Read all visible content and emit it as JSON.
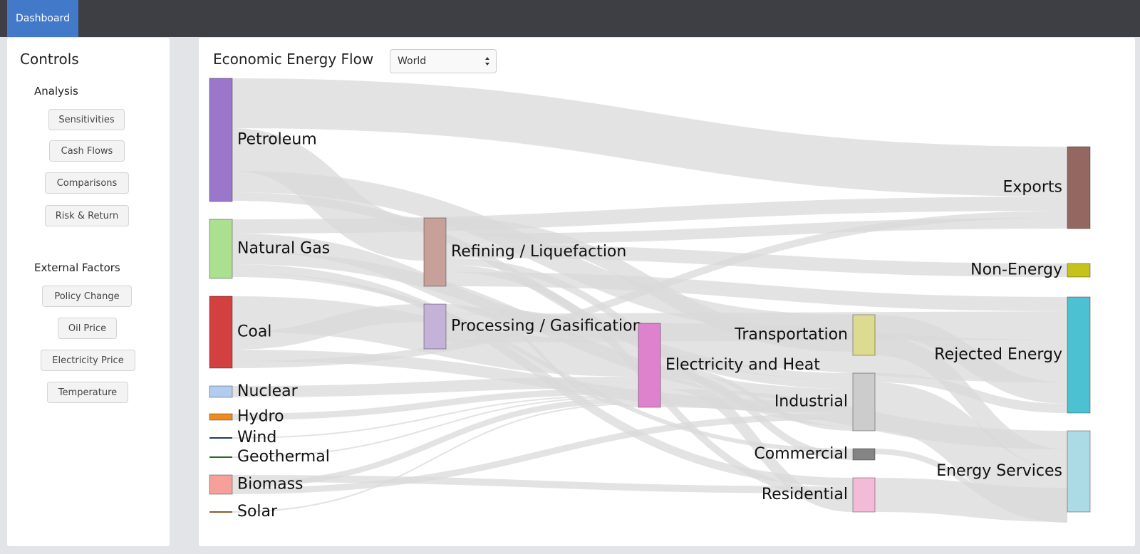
{
  "nav": {
    "tab_label": "Dashboard"
  },
  "sidebar": {
    "title": "Controls",
    "analysis": {
      "heading": "Analysis",
      "buttons": [
        "Sensitivities",
        "Cash Flows",
        "Comparisons",
        "Risk & Return"
      ]
    },
    "external": {
      "heading": "External Factors",
      "buttons": [
        "Policy Change",
        "Oil Price",
        "Electricity Price",
        "Temperature"
      ]
    }
  },
  "main": {
    "title": "Economic Energy Flow",
    "region_select": {
      "value": "World"
    }
  },
  "sankey": {
    "link_color": "#d9d9d9",
    "nodes": [
      {
        "name": "Petroleum",
        "color": "#9b77cc"
      },
      {
        "name": "Natural Gas",
        "color": "#aae08f"
      },
      {
        "name": "Coal",
        "color": "#d24040"
      },
      {
        "name": "Nuclear",
        "color": "#b3cbee"
      },
      {
        "name": "Hydro",
        "color": "#f08a1a"
      },
      {
        "name": "Wind",
        "color": "#1f3d5c"
      },
      {
        "name": "Geothermal",
        "color": "#2b6a1c"
      },
      {
        "name": "Biomass",
        "color": "#f7a09a"
      },
      {
        "name": "Solar",
        "color": "#8b5a2b"
      },
      {
        "name": "Refining / Liquefaction",
        "color": "#c7a199"
      },
      {
        "name": "Processing / Gasification",
        "color": "#c4b2d9"
      },
      {
        "name": "Electricity and Heat",
        "color": "#df82ce"
      },
      {
        "name": "Transportation",
        "color": "#dcdb8f"
      },
      {
        "name": "Industrial",
        "color": "#cccccc"
      },
      {
        "name": "Commercial",
        "color": "#848484"
      },
      {
        "name": "Residential",
        "color": "#f2bcd8"
      },
      {
        "name": "Exports",
        "color": "#946860"
      },
      {
        "name": "Non-Energy",
        "color": "#c4c21b"
      },
      {
        "name": "Rejected Energy",
        "color": "#4cc1d2"
      },
      {
        "name": "Energy Services",
        "color": "#acdbe6"
      }
    ]
  }
}
